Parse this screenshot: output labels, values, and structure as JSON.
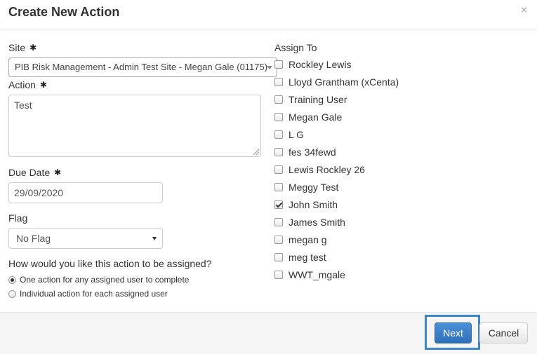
{
  "modal": {
    "title": "Create New Action",
    "close_symbol": "×"
  },
  "form": {
    "site_label": "Site",
    "site_value": "PIB Risk Management - Admin Test Site - Megan Gale (01175)",
    "action_label": "Action",
    "action_value": "Test",
    "due_date_label": "Due Date",
    "due_date_value": "29/09/2020",
    "flag_label": "Flag",
    "flag_value": "No Flag",
    "assign_question": "How would you like this action to be assigned?",
    "assign_options": [
      {
        "label": "One action for any assigned user to complete",
        "selected": true
      },
      {
        "label": "Individual action for each assigned user",
        "selected": false
      }
    ],
    "required_marker": "✱"
  },
  "assign_to": {
    "label": "Assign To",
    "users": [
      {
        "name": "Rockley Lewis",
        "checked": false
      },
      {
        "name": "Lloyd Grantham (xCenta)",
        "checked": false
      },
      {
        "name": "Training User",
        "checked": false
      },
      {
        "name": "Megan Gale",
        "checked": false
      },
      {
        "name": "L G",
        "checked": false
      },
      {
        "name": "fes 34fewd",
        "checked": false
      },
      {
        "name": "Lewis Rockley 26",
        "checked": false
      },
      {
        "name": "Meggy Test",
        "checked": false
      },
      {
        "name": "John Smith",
        "checked": true
      },
      {
        "name": "James Smith",
        "checked": false
      },
      {
        "name": "megan g",
        "checked": false
      },
      {
        "name": "meg test",
        "checked": false
      },
      {
        "name": "WWT_mgale",
        "checked": false
      }
    ]
  },
  "footer": {
    "next_label": "Next",
    "cancel_label": "Cancel"
  },
  "colors": {
    "primary": "#337ab7",
    "highlight": "#3a86c8"
  }
}
